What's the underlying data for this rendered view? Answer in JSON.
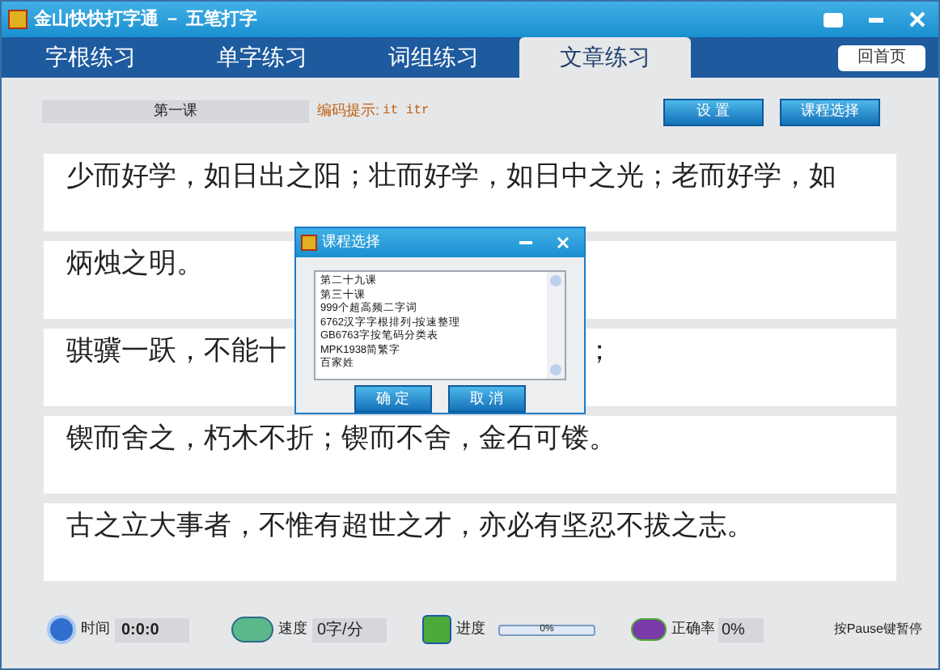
{
  "window": {
    "title": "金山快快打字通 － 五笔打字"
  },
  "tabs": [
    {
      "label": "字根练习",
      "selected": false
    },
    {
      "label": "单字练习",
      "selected": false
    },
    {
      "label": "词组练习",
      "selected": false
    },
    {
      "label": "文章练习",
      "selected": true
    }
  ],
  "home_button": "回首页",
  "toolbar": {
    "lesson": "第一课",
    "hint_label": "编码提示:",
    "hint_code": "it itr",
    "buttons": [
      "设 置",
      "课程选择"
    ]
  },
  "lines": [
    {
      "text": "少而好学，如日出之阳；壮而好学，如日中之光；老而好学，如"
    },
    {
      "text": "炳烛之明。"
    },
    {
      "text": "骐骥一跃，不能十",
      "text_after": "；"
    },
    {
      "text": "锲而舍之，朽木不折；锲而不舍，金石可镂。"
    },
    {
      "text": "古之立大事者，不惟有超世之才，亦必有坚忍不拔之志。"
    }
  ],
  "dialog": {
    "title": "课程选择",
    "items": [
      {
        "label": "第二十九课",
        "selected": false
      },
      {
        "label": "第三十课",
        "selected": false
      },
      {
        "label": "999个超高频二字词",
        "selected": false
      },
      {
        "label": "6762汉字字根排列-按速整理",
        "selected": false
      },
      {
        "label": "GB6763字按笔码分类表",
        "selected": false
      },
      {
        "label": "MPK1938简繁字",
        "selected": false
      },
      {
        "label": "百家姓",
        "selected": false
      }
    ],
    "buttons": [
      "确 定",
      "取 消"
    ]
  },
  "status_bar": {
    "time_label": "时间",
    "time": "0:0:0",
    "speed_label": "速度",
    "speed": "0字/分",
    "progress_label": "进度",
    "progress": {
      "level": 0,
      "reading": "0%"
    },
    "accuracy_label": "正确率",
    "accuracy": "0%",
    "pause_hint": "按Pause键暂停"
  }
}
